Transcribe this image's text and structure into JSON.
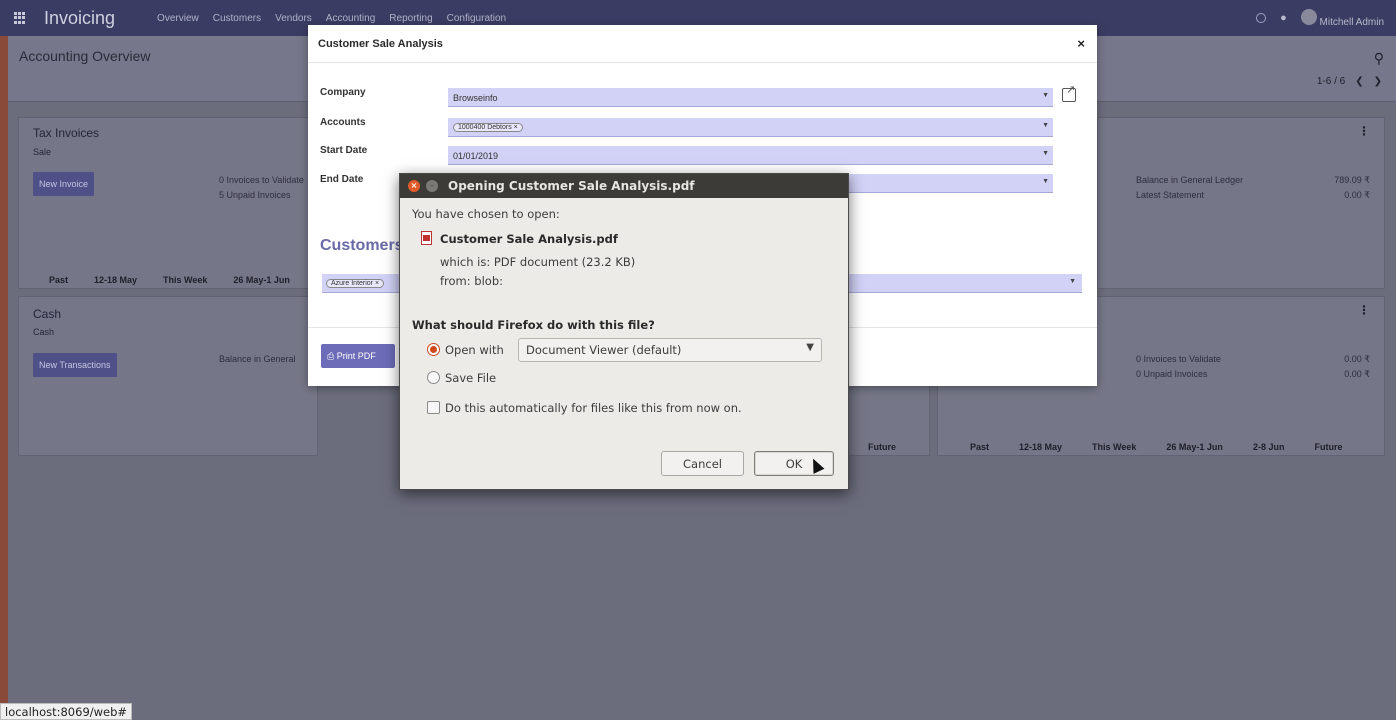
{
  "navbar": {
    "app_name": "Invoicing",
    "menu": [
      "Overview",
      "Customers",
      "Vendors",
      "Accounting",
      "Reporting",
      "Configuration"
    ],
    "user_name": "Mitchell Admin"
  },
  "page": {
    "title": "Accounting Overview",
    "pager": "1-6 / 6"
  },
  "cards": {
    "tax_invoices": {
      "title": "Tax Invoices",
      "subtitle": "Sale",
      "button": "New Invoice",
      "line1": "0 Invoices to Validate",
      "line2": "5 Unpaid Invoices",
      "axis": [
        "Past",
        "12-18 May",
        "This Week",
        "26 May-1 Jun"
      ]
    },
    "cash": {
      "title": "Cash",
      "subtitle": "Cash",
      "button": "New Transactions",
      "line1": "Balance in General"
    },
    "bank": {
      "line1": "Balance in General Ledger",
      "line2": "Latest Statement",
      "val1": "789.09 ₹",
      "val2": "0.00 ₹"
    },
    "vendor_bills": {
      "line1": "0 Invoices to Validate",
      "line2": "0 Unpaid Invoices",
      "val1": "0.00 ₹",
      "val2": "0.00 ₹",
      "axis": [
        "Past",
        "12-18 May",
        "This Week",
        "26 May-1 Jun",
        "2-8 Jun",
        "Future"
      ],
      "left_axis_future": "Future"
    }
  },
  "modal": {
    "title": "Customer Sale Analysis",
    "close": "×",
    "fields": {
      "company_label": "Company",
      "company_value": "Browseinfo",
      "accounts_label": "Accounts",
      "accounts_tags": [
        "1000400",
        "Debtors"
      ],
      "start_label": "Start Date",
      "start_value": "01/01/2019",
      "end_label": "End Date"
    },
    "section_title": "Customers",
    "customer_tag": "Azure Interior",
    "print_button": "Print PDF"
  },
  "ff_dialog": {
    "title": "Opening Customer Sale Analysis.pdf",
    "chosen_text": "You have chosen to open:",
    "file_name": "Customer Sale Analysis.pdf",
    "which_is": "which is: PDF document (23.2 KB)",
    "from": "from: blob:",
    "question": "What should Firefox do with this file?",
    "open_with_label": "Open with",
    "open_with_app": "Document Viewer (default)",
    "save_file_label": "Save File",
    "auto_label": "Do this automatically for files like this from now on.",
    "cancel": "Cancel",
    "ok": "OK"
  },
  "status_url": "localhost:8069/web#"
}
